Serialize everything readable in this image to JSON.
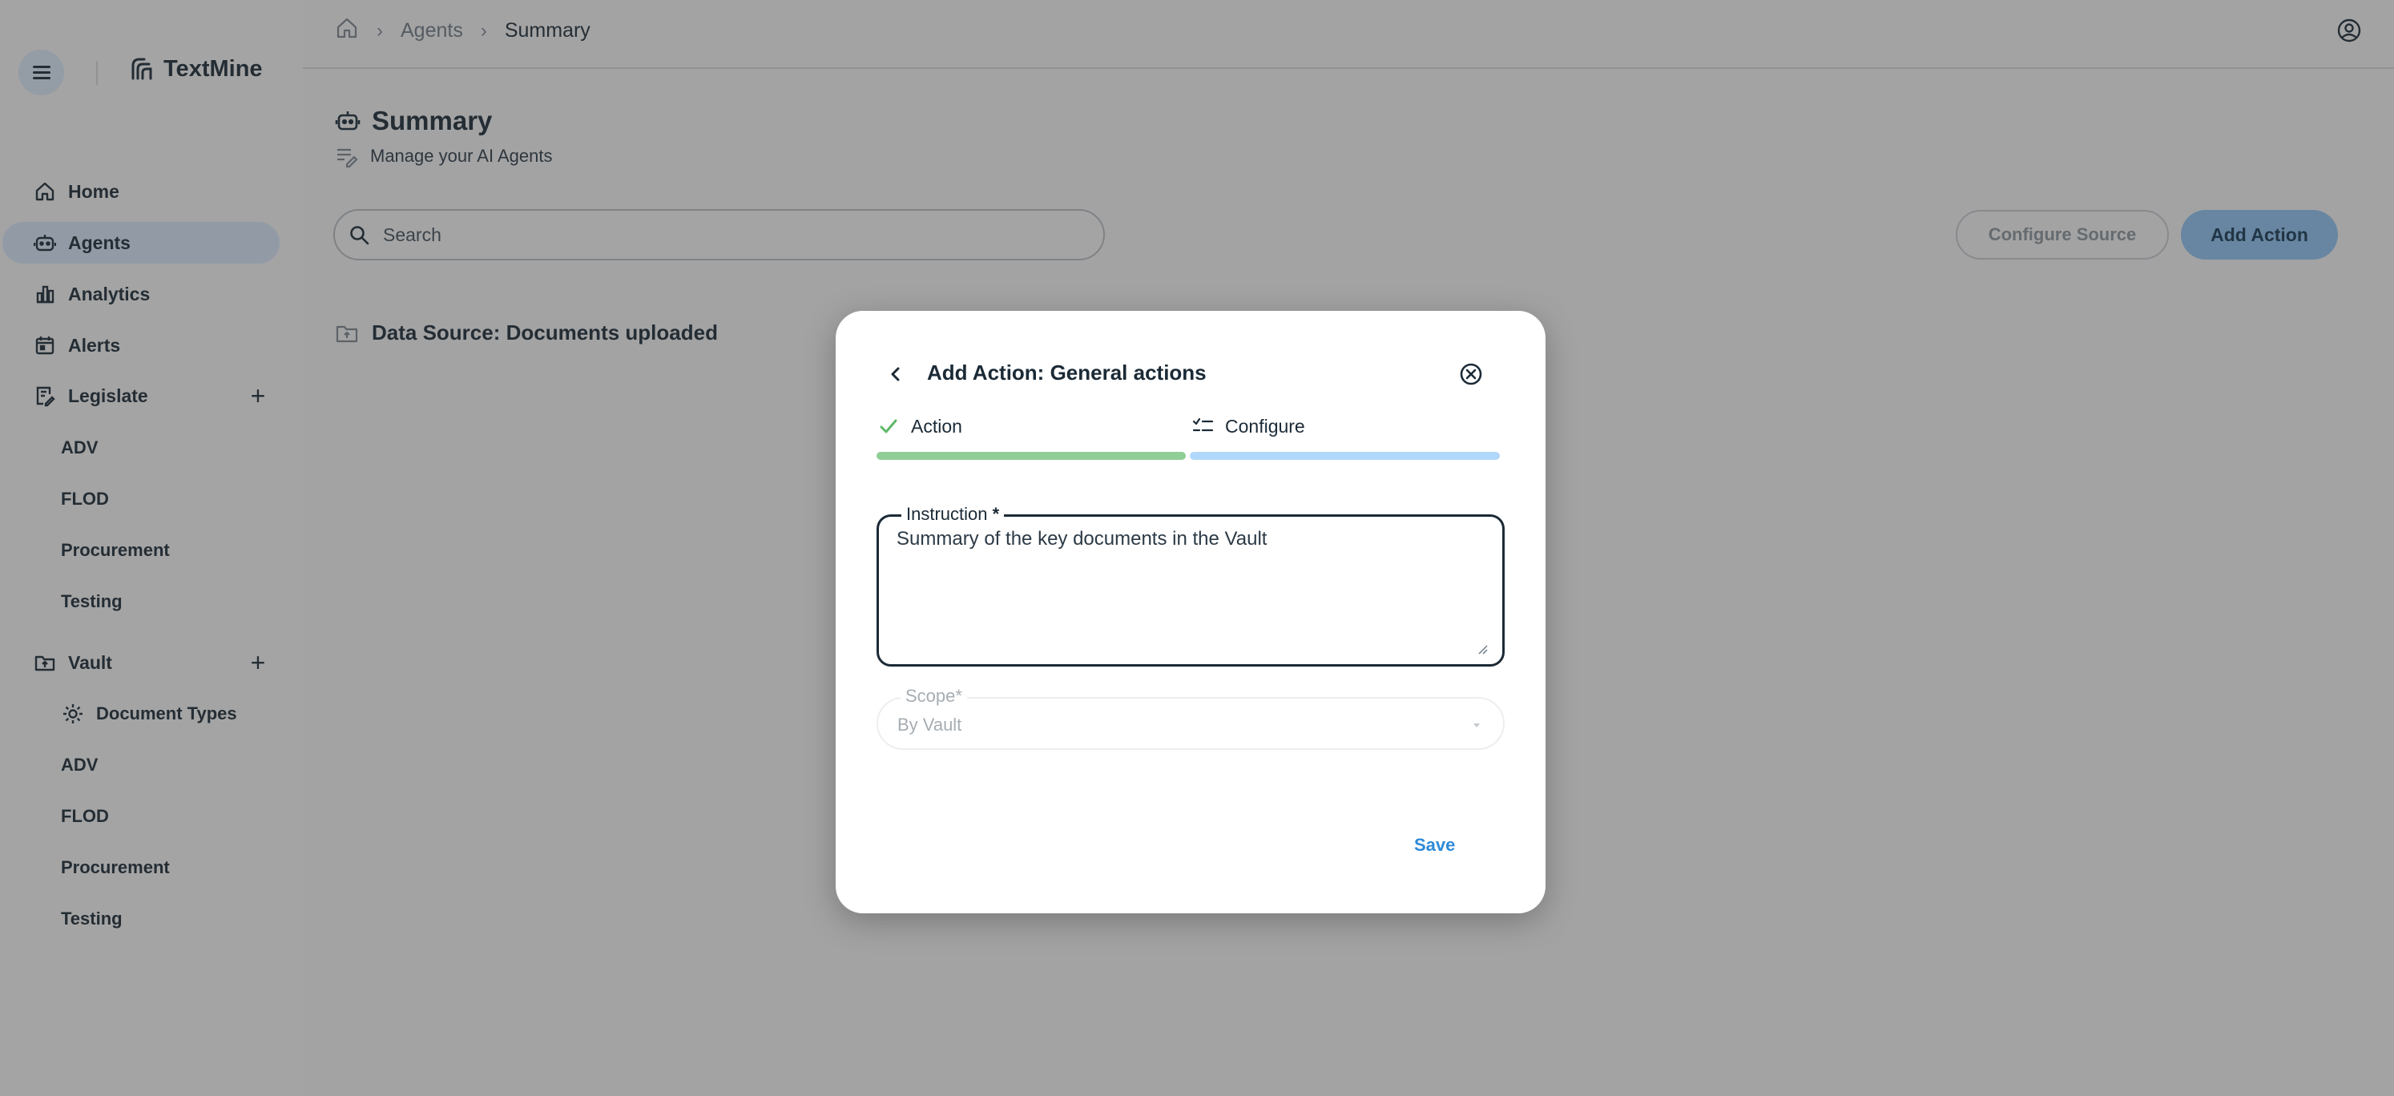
{
  "app": {
    "name": "TextMine"
  },
  "sidebar": {
    "items": [
      {
        "label": "Home"
      },
      {
        "label": "Agents"
      },
      {
        "label": "Analytics"
      },
      {
        "label": "Alerts"
      },
      {
        "label": "Legislate"
      },
      {
        "label": "Vault"
      }
    ],
    "legislate_children": [
      "ADV",
      "FLOD",
      "Procurement",
      "Testing"
    ],
    "vault_children": [
      "Document Types",
      "ADV",
      "FLOD",
      "Procurement",
      "Testing"
    ]
  },
  "breadcrumb": {
    "agents": "Agents",
    "current": "Summary"
  },
  "page": {
    "title": "Summary",
    "subtitle": "Manage your AI Agents",
    "search_placeholder": "Search",
    "configure_source": "Configure Source",
    "add_action": "Add Action",
    "data_source": "Data Source: Documents uploaded"
  },
  "dialog": {
    "title": "Add Action: General actions",
    "steps": [
      {
        "label": "Action",
        "state": "complete",
        "color": "#8fce96"
      },
      {
        "label": "Configure",
        "state": "current",
        "color": "#b1d8fa"
      }
    ],
    "instruction_label": "Instruction",
    "instruction_required": "*",
    "instruction_value": "Summary of the key documents in the Vault",
    "scope_label": "Scope*",
    "scope_value": "By Vault",
    "save_label": "Save"
  },
  "colors": {
    "accent": "#8fc3f2",
    "active_nav": "#d7e7f8",
    "link": "#2e8bd8"
  }
}
